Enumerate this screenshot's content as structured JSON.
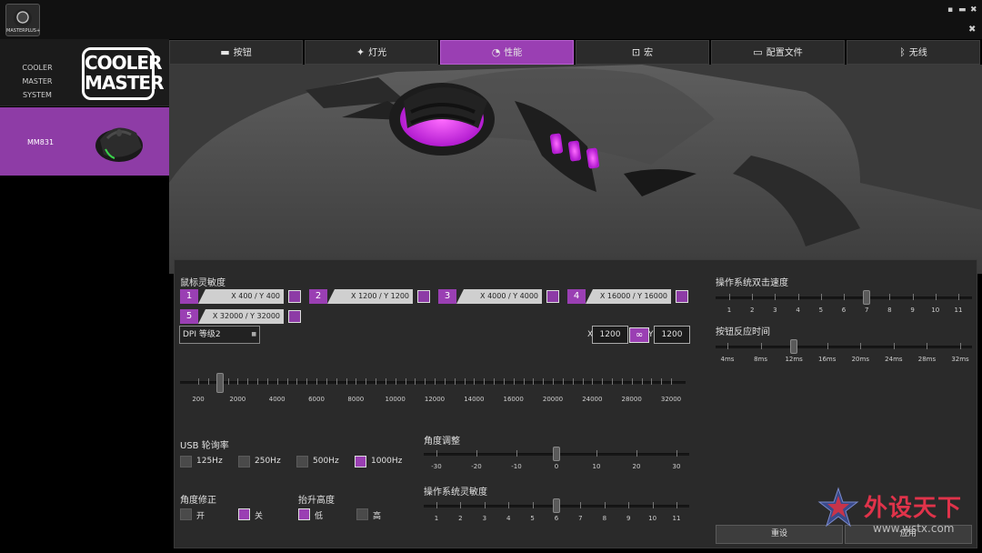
{
  "app": {
    "logo_text": "MASTERPLUS+"
  },
  "window": {
    "minimize": "▪",
    "maximize": "▬",
    "close": "✖",
    "pin": "✖"
  },
  "sidebar": {
    "brand_system": "COOLER MASTER SYSTEM",
    "brand_logo": [
      "COOLER",
      "MASTER"
    ],
    "device": {
      "name": "MM831"
    }
  },
  "tabs": [
    {
      "label": "按钮",
      "icon": "mouse-icon",
      "glyph": "▬"
    },
    {
      "label": "灯光",
      "icon": "lightbulb-icon",
      "glyph": "✦"
    },
    {
      "label": "性能",
      "icon": "gauge-icon",
      "glyph": "◔"
    },
    {
      "label": "宏",
      "icon": "macro-icon",
      "glyph": "⊡"
    },
    {
      "label": "配置文件",
      "icon": "profile-icon",
      "glyph": "▭"
    },
    {
      "label": "无线",
      "icon": "bluetooth-icon",
      "glyph": "ᛒ"
    }
  ],
  "active_tab": 2,
  "sensitivity": {
    "title": "鼠标灵敏度",
    "slots": [
      {
        "num": "1",
        "value": "X 400 / Y 400"
      },
      {
        "num": "2",
        "value": "X 1200 / Y 1200"
      },
      {
        "num": "3",
        "value": "X 4000 / Y 4000"
      },
      {
        "num": "4",
        "value": "X 16000 / Y 16000"
      },
      {
        "num": "5",
        "value": "X 32000 / Y 32000"
      }
    ],
    "dpi_level": "DPI 等级2",
    "x_label": "X",
    "y_label": "Y",
    "x_value": "1200",
    "y_value": "1200",
    "link_glyph": "∞",
    "ticks": [
      "200",
      "2000",
      "4000",
      "6000",
      "8000",
      "10000",
      "12000",
      "14000",
      "16000",
      "20000",
      "24000",
      "28000",
      "32000"
    ],
    "thumb_value": "1200"
  },
  "polling": {
    "title": "USB 轮询率",
    "options": [
      "125Hz",
      "250Hz",
      "500Hz",
      "1000Hz"
    ],
    "selected": 3
  },
  "angle_snap": {
    "title": "角度修正",
    "options": [
      "开",
      "关"
    ],
    "selected": 1
  },
  "lift_off": {
    "title": "抬升高度",
    "options": [
      "低",
      "高"
    ],
    "selected": 0
  },
  "angle_adjust": {
    "title": "角度调整",
    "ticks": [
      "-30",
      "-20",
      "-10",
      "0",
      "10",
      "20",
      "30"
    ],
    "value": 0
  },
  "os_sensitivity": {
    "title": "操作系统灵敏度",
    "ticks": [
      "1",
      "2",
      "3",
      "4",
      "5",
      "6",
      "7",
      "8",
      "9",
      "10",
      "11"
    ],
    "value": 6
  },
  "double_click": {
    "title": "操作系统双击速度",
    "ticks": [
      "1",
      "2",
      "3",
      "4",
      "5",
      "6",
      "7",
      "8",
      "9",
      "10",
      "11"
    ],
    "value": 7
  },
  "response_time": {
    "title": "按钮反应时间",
    "ticks": [
      "4ms",
      "8ms",
      "12ms",
      "16ms",
      "20ms",
      "24ms",
      "28ms",
      "32ms"
    ],
    "value": "12ms"
  },
  "actions": {
    "reset": "重设",
    "apply": "应用"
  },
  "watermark": {
    "text": "外设天下",
    "url": "www.wstx.com"
  },
  "colors": {
    "accent": "#9a3fb3",
    "panel": "#2a2a2a",
    "watermark": "#e0334a"
  }
}
